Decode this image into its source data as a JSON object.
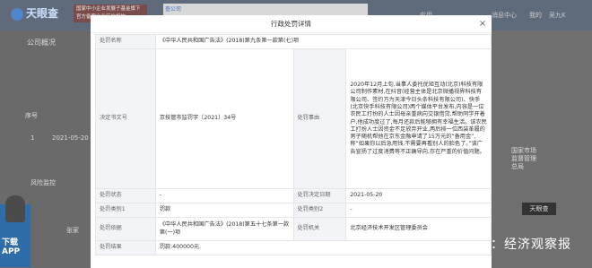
{
  "background": {
    "logo": "天眼查",
    "ad_text": "国家中小企业发展子基金旗下 官方备案企业征信机构",
    "search_tab": "查公司",
    "nav_items": [
      "应用",
      "消息中心",
      "我的",
      "吴九K"
    ],
    "side_labels": [
      "公司概况",
      "序号",
      "1",
      "2021-05-20",
      "风险监控",
      "张家"
    ],
    "right_labels": [
      "国家市场监督管理总局",
      "天眼查"
    ],
    "promo": "下载APP",
    "watermark": "雪球：经济观察报"
  },
  "modal": {
    "title": "行政处罚详情",
    "close_icon": "×",
    "rows": [
      {
        "label": "处罚名称",
        "value": "《中华人民共和国广告法》(2018)第九条第一款第(七)项"
      },
      {
        "label": "决定书文号",
        "value": "京技管市监罚字〔2021〕34号",
        "label2": "处罚事由",
        "value2": "2020年12月上旬,当事人委托优矩互动(北京)科技有限公司制作素材,在抖音(经营主体是北京微播视界科技有限公司、签约方为天津今日头条科技有限公司)、快手(北京快手科技有限公司)两个媒体平台发布,内容是一位农民工打扮的人士因母亲重病向交银借贷,帮助同学开着户,他成功度过了,每月还款后能够拥有幸福生活..."
      },
      {
        "label": "处罚状态",
        "value": "-",
        "label2": "处罚决定日期",
        "value2": "2021-05-20"
      },
      {
        "label": "处罚类别1",
        "value": "罚款",
        "label2": "处罚类别2",
        "value2": "-"
      },
      {
        "label": "处罚依据",
        "value": "《中华人民共和国广告法》(2018)第五十七条第一款第(一)项",
        "label2": "处罚机关",
        "value2": "北京经济技术开发区管理委员会"
      },
      {
        "label": "处罚结果",
        "value": "罚款:400000元."
      }
    ],
    "reason_full": "2020年12月上旬,当事人委托优矩互动(北京)科技有限公司制作素材,在抖音(经营主体是北京微播视界科技有限公司、签约方为天津今日头条科技有限公司)、快手(北京快手科技有限公司)两个媒体平台发布,内容是一位农民工打扮的人士因母亲重病向交银借贷,帮助同学开着户,他成功度过了,每月还款后能够拥有幸福生活。该农民工打扮人士因资金不足放弃开业,两后排一位西装革履的男子随机帮他在京东金融申请了15万元的“备用金”,称“如果你以后急用钱,不需要再看别人的脸色了。”该广告宣扬了过度消费等不正确导向,存在严重的价值问题。"
  }
}
